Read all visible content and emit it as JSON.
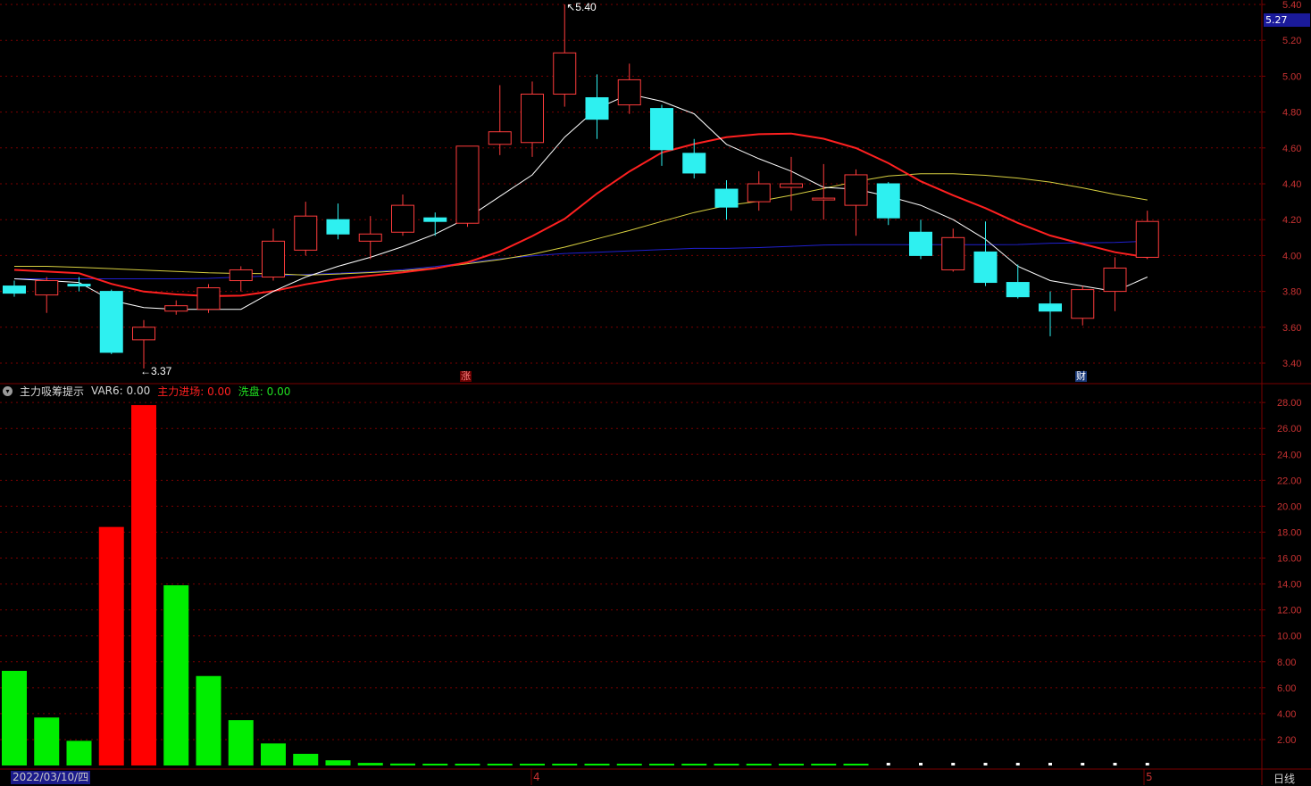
{
  "colors": {
    "up": "#ff3c3c",
    "down": "#2ef0f0",
    "grid": "#7a0000",
    "axis_text": "#c83232",
    "ma5": "#ffffff",
    "ma10": "#ff2020",
    "ma20": "#d8d040",
    "ma60": "#2020d0",
    "bar_red": "#ff0000",
    "bar_green": "#00ee00"
  },
  "price_panel": {
    "current_price_tag": "5.27",
    "y_ticks": [
      "5.40",
      "5.20",
      "5.00",
      "4.80",
      "4.60",
      "4.40",
      "4.20",
      "4.00",
      "3.80",
      "3.60",
      "3.40"
    ],
    "high_label": "5.40",
    "low_label": "3.37",
    "marker_zhang": "涨",
    "marker_cai": "财"
  },
  "indicator_panel": {
    "name": "主力吸筹提示",
    "var6": "VAR6: 0.00",
    "main_entry": "主力进场: 0.00",
    "wash": "洗盘: 0.00",
    "y_ticks": [
      "28.00",
      "26.00",
      "24.00",
      "22.00",
      "20.00",
      "18.00",
      "16.00",
      "14.00",
      "12.00",
      "10.00",
      "8.00",
      "6.00",
      "4.00",
      "2.00"
    ]
  },
  "footer": {
    "start_date": "2022/03/10/四",
    "month_4": "4",
    "month_5": "5",
    "period": "日线"
  },
  "chart_data": [
    {
      "type": "candlestick",
      "ylim": [
        3.3,
        5.45
      ],
      "candles": [
        {
          "o": 3.83,
          "c": 3.79,
          "h": 3.86,
          "l": 3.77
        },
        {
          "o": 3.78,
          "c": 3.86,
          "h": 3.88,
          "l": 3.68
        },
        {
          "o": 3.84,
          "c": 3.83,
          "h": 3.88,
          "l": 3.8
        },
        {
          "o": 3.8,
          "c": 3.46,
          "h": 3.81,
          "l": 3.45
        },
        {
          "o": 3.53,
          "c": 3.6,
          "h": 3.64,
          "l": 3.37
        },
        {
          "o": 3.69,
          "c": 3.72,
          "h": 3.75,
          "l": 3.67
        },
        {
          "o": 3.7,
          "c": 3.82,
          "h": 3.84,
          "l": 3.68
        },
        {
          "o": 3.86,
          "c": 3.92,
          "h": 3.94,
          "l": 3.8
        },
        {
          "o": 3.88,
          "c": 4.08,
          "h": 4.15,
          "l": 3.86
        },
        {
          "o": 4.03,
          "c": 4.22,
          "h": 4.3,
          "l": 4.0
        },
        {
          "o": 4.2,
          "c": 4.12,
          "h": 4.29,
          "l": 4.09
        },
        {
          "o": 4.08,
          "c": 4.12,
          "h": 4.22,
          "l": 3.98
        },
        {
          "o": 4.13,
          "c": 4.28,
          "h": 4.34,
          "l": 4.11
        },
        {
          "o": 4.21,
          "c": 4.19,
          "h": 4.24,
          "l": 4.11
        },
        {
          "o": 4.18,
          "c": 4.61,
          "h": 4.61,
          "l": 4.16
        },
        {
          "o": 4.62,
          "c": 4.69,
          "h": 4.95,
          "l": 4.56
        },
        {
          "o": 4.63,
          "c": 4.9,
          "h": 4.97,
          "l": 4.55
        },
        {
          "o": 4.9,
          "c": 5.13,
          "h": 5.4,
          "l": 4.83
        },
        {
          "o": 4.88,
          "c": 4.76,
          "h": 5.01,
          "l": 4.65
        },
        {
          "o": 4.84,
          "c": 4.98,
          "h": 5.07,
          "l": 4.79
        },
        {
          "o": 4.82,
          "c": 4.59,
          "h": 4.84,
          "l": 4.5
        },
        {
          "o": 4.57,
          "c": 4.46,
          "h": 4.65,
          "l": 4.43
        },
        {
          "o": 4.37,
          "c": 4.27,
          "h": 4.42,
          "l": 4.2
        },
        {
          "o": 4.3,
          "c": 4.4,
          "h": 4.47,
          "l": 4.25
        },
        {
          "o": 4.38,
          "c": 4.4,
          "h": 4.55,
          "l": 4.25
        },
        {
          "o": 4.31,
          "c": 4.32,
          "h": 4.51,
          "l": 4.2
        },
        {
          "o": 4.28,
          "c": 4.45,
          "h": 4.48,
          "l": 4.11
        },
        {
          "o": 4.4,
          "c": 4.21,
          "h": 4.41,
          "l": 4.17
        },
        {
          "o": 4.13,
          "c": 4.0,
          "h": 4.2,
          "l": 3.98
        },
        {
          "o": 3.92,
          "c": 4.1,
          "h": 4.15,
          "l": 3.91
        },
        {
          "o": 4.02,
          "c": 3.85,
          "h": 4.19,
          "l": 3.83
        },
        {
          "o": 3.85,
          "c": 3.77,
          "h": 3.95,
          "l": 3.76
        },
        {
          "o": 3.73,
          "c": 3.69,
          "h": 3.8,
          "l": 3.55
        },
        {
          "o": 3.65,
          "c": 3.81,
          "h": 3.83,
          "l": 3.61
        },
        {
          "o": 3.8,
          "c": 3.93,
          "h": 3.99,
          "l": 3.69
        },
        {
          "o": 3.99,
          "c": 4.19,
          "h": 4.25,
          "l": 3.98
        }
      ],
      "ma5": [
        3.87,
        3.86,
        3.85,
        3.75,
        3.71,
        3.7,
        3.7,
        3.7,
        3.8,
        3.88,
        3.94,
        3.99,
        4.05,
        4.12,
        4.21,
        4.33,
        4.45,
        4.66,
        4.82,
        4.9,
        4.86,
        4.79,
        4.62,
        4.54,
        4.47,
        4.38,
        4.37,
        4.33,
        4.28,
        4.2,
        4.09,
        3.94,
        3.86,
        3.83,
        3.8,
        3.88
      ],
      "ma10": [
        3.92,
        3.91,
        3.9,
        3.83,
        3.79,
        3.78,
        3.77,
        3.78,
        3.82,
        3.86,
        3.88,
        3.9,
        3.92,
        3.95,
        4.01,
        4.1,
        4.2,
        4.35,
        4.48,
        4.59,
        4.63,
        4.67,
        4.68,
        4.68,
        4.63,
        4.57,
        4.45,
        4.36,
        4.29,
        4.2,
        4.12,
        4.07,
        4.02,
        3.99
      ],
      "ma10_start": 0,
      "ma20": [
        3.94,
        3.94,
        3.93,
        3.92,
        3.91,
        3.9,
        3.9,
        3.89,
        3.9,
        3.91,
        3.93,
        3.96,
        3.99,
        4.04,
        4.1,
        4.16,
        4.23,
        4.28,
        4.31,
        4.36,
        4.41,
        4.45,
        4.46,
        4.45,
        4.43,
        4.4,
        4.35,
        4.31
      ],
      "ma20_start": 0,
      "ma60": [
        3.87,
        3.87,
        3.87,
        3.87,
        3.87,
        3.88,
        3.89,
        3.9,
        3.91,
        3.93,
        3.96,
        3.99,
        4.01,
        4.02,
        4.03,
        4.04,
        4.04,
        4.05,
        4.06,
        4.06,
        4.06,
        4.06,
        4.06,
        4.07,
        4.07,
        4.08
      ],
      "ma60_start": 0
    },
    {
      "type": "bar",
      "ylim": [
        0,
        29
      ],
      "values": [
        7.3,
        3.7,
        1.9,
        18.4,
        27.8,
        13.9,
        6.9,
        3.5,
        1.7,
        0.9,
        0.4,
        0.2,
        0.15,
        0.1,
        0.08,
        0.05,
        0.05,
        0.05,
        0.05,
        0.05,
        0.05,
        0.05,
        0.05,
        0.05,
        0.05,
        0.05,
        0.05,
        0.0,
        0.0,
        0.0,
        0.0,
        0.0,
        0.0,
        0.0,
        0.0,
        0.0
      ],
      "colors": [
        "green",
        "green",
        "green",
        "red",
        "red",
        "green",
        "green",
        "green",
        "green",
        "green",
        "green",
        "green",
        "green",
        "green",
        "green",
        "green",
        "green",
        "green",
        "green",
        "green",
        "green",
        "green",
        "green",
        "green",
        "green",
        "green",
        "green",
        "green",
        "green",
        "green",
        "green",
        "green",
        "green",
        "green",
        "green",
        "green"
      ]
    }
  ]
}
